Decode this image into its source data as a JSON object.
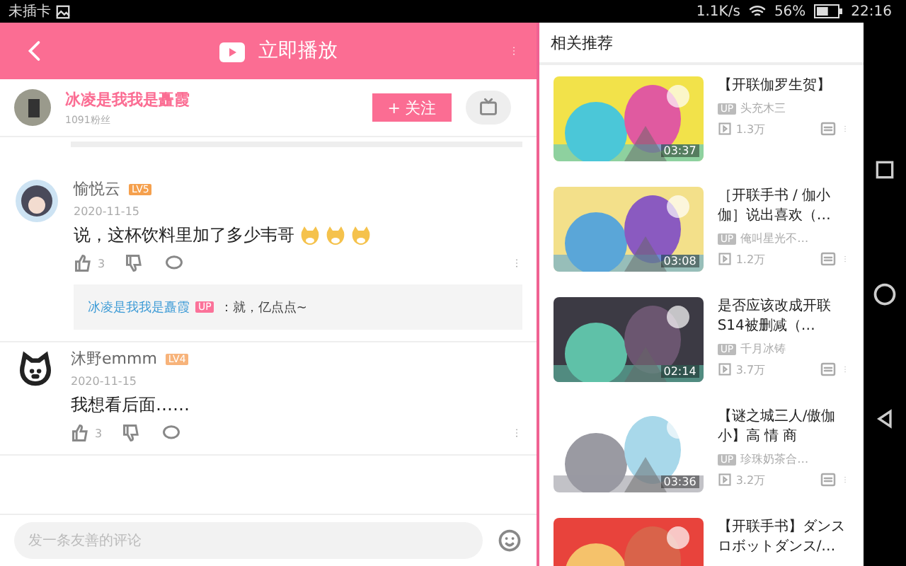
{
  "status_bar": {
    "carrier": "未插卡",
    "speed": "1.1K/s",
    "battery_text": "56%",
    "time": "22:16",
    "battery": {
      "level": 0.56
    }
  },
  "header": {
    "title": "立即播放"
  },
  "uploader": {
    "name": "冰凌是我我是矗霞",
    "fans": "1091粉丝",
    "follow_plus": "+",
    "follow_label": "关注"
  },
  "comments": [
    {
      "user": "愉悦云",
      "level_badge": "LV5",
      "date": "2020-11-15",
      "text": "说，这杯饮料里加了多少韦哥",
      "emojis": [
        {
          "kind": "doge"
        },
        {
          "kind": "doge"
        },
        {
          "kind": "doge"
        }
      ],
      "likes": "3",
      "avatar": {
        "kind": "portrait"
      },
      "reply": {
        "user": "冰凌是我我是矗霞",
        "badge": "UP",
        "text": "：就，亿点点~"
      }
    },
    {
      "user": "沐野emmm",
      "level_badge": "LV4",
      "date": "2020-11-15",
      "text": "我想看后面……",
      "likes": "3",
      "avatar": {
        "kind": "cat"
      }
    }
  ],
  "comment_input": {
    "placeholder": "发一条友善的评论"
  },
  "related": {
    "title": "相关推荐",
    "videos": [
      {
        "title": "【开联伽罗生贺】",
        "up_badge": "UP",
        "up": "头充木三",
        "views": "1.3万",
        "duration": "03:37"
      },
      {
        "title": "［开联手书 / 伽小伽］说出喜欢（…",
        "up_badge": "UP",
        "up": "俺叫星光不…",
        "views": "1.2万",
        "duration": "03:08"
      },
      {
        "title": "是否应该改成开联S14被删减（…",
        "up_badge": "UP",
        "up": "千月冰铸",
        "views": "3.7万",
        "duration": "02:14"
      },
      {
        "title": "【谜之城三人/傲伽小】高 情 商",
        "up_badge": "UP",
        "up": "珍珠奶茶合…",
        "views": "3.2万",
        "duration": "03:36"
      },
      {
        "title": "【开联手书】ダンスロボットダンス/…"
      }
    ]
  }
}
